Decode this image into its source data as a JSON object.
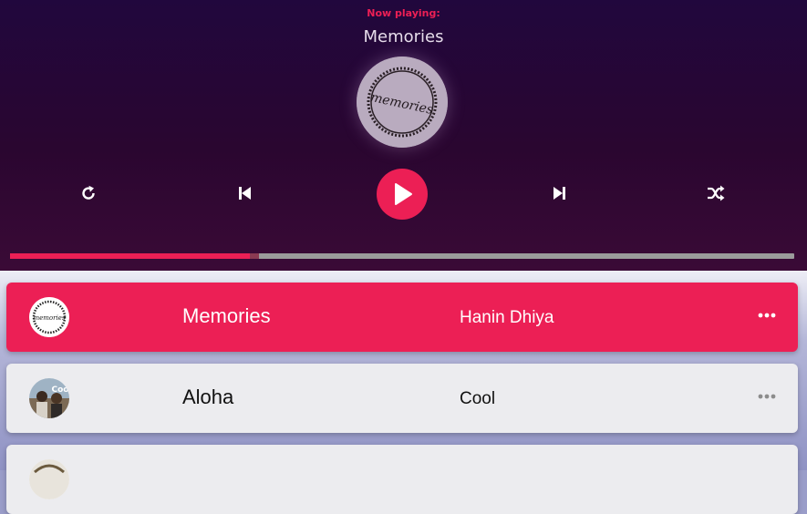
{
  "player": {
    "now_playing_label": "Now playing:",
    "current_title": "Memories",
    "cd_art_text": "memories",
    "progress": 0.31,
    "controls": {
      "repeat_icon": "repeat-icon",
      "prev_icon": "skip-back-icon",
      "play_icon": "play-icon",
      "next_icon": "skip-forward-icon",
      "shuffle_icon": "shuffle-icon"
    }
  },
  "playlist": [
    {
      "title": "Memories",
      "artist": "Hanin Dhiya",
      "active": true,
      "thumb_text": "memories"
    },
    {
      "title": "Aloha",
      "artist": "Cool",
      "active": false,
      "thumb_text": "Coo"
    },
    {
      "title": "",
      "artist": "",
      "active": false,
      "thumb_text": ""
    }
  ],
  "colors": {
    "accent": "#ec1f55",
    "player_bg": "#2a0630",
    "card_bg": "#ececef"
  }
}
